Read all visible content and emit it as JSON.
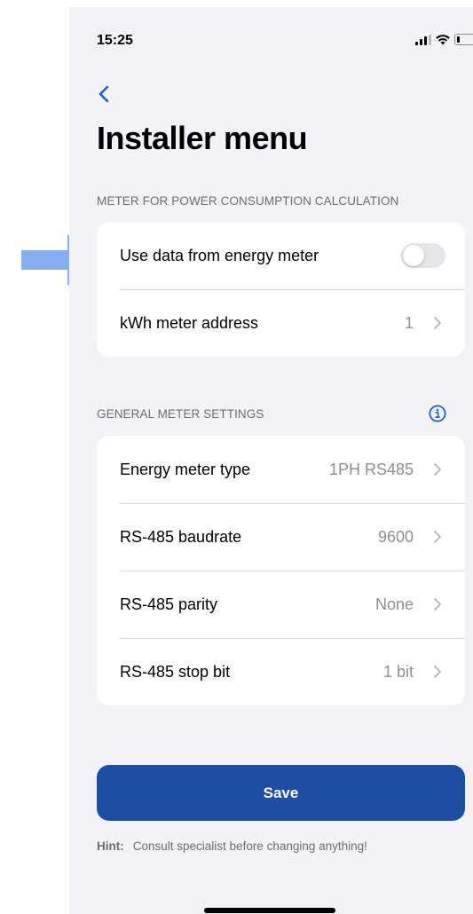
{
  "status_bar": {
    "time": "15:25"
  },
  "title": "Installer menu",
  "sections": {
    "meter_power": {
      "header": "METER FOR POWER CONSUMPTION CALCULATION",
      "use_energy_meter": {
        "label": "Use data from energy meter",
        "enabled": false
      },
      "kwh_address": {
        "label": "kWh meter address",
        "value": "1"
      }
    },
    "general": {
      "header": "GENERAL METER SETTINGS",
      "info_icon": "info-circle-icon",
      "rows": [
        {
          "label": "Energy meter type",
          "value": "1PH RS485"
        },
        {
          "label": "RS-485 baudrate",
          "value": "9600"
        },
        {
          "label": "RS-485 parity",
          "value": "None"
        },
        {
          "label": "RS-485 stop bit",
          "value": "1 bit"
        }
      ]
    }
  },
  "save_label": "Save",
  "hint": {
    "label": "Hint:",
    "text": "Consult specialist before changing anything!"
  },
  "colors": {
    "accent": "#1c4fa3",
    "link": "#1e62c8",
    "background": "#f2f2f7",
    "annotation_arrow": "#86aef0"
  }
}
